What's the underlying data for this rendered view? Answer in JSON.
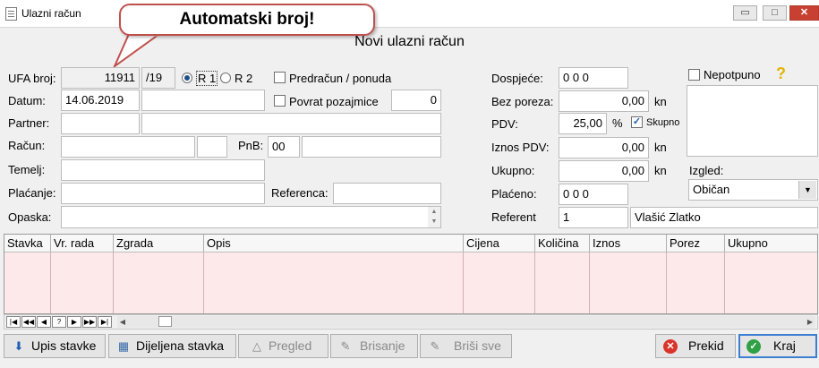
{
  "window": {
    "title": "Ulazni račun",
    "min": "▭",
    "max": "□",
    "close": "✕"
  },
  "callout": {
    "text": "Automatski broj!"
  },
  "form_title": "Novi ulazni račun",
  "left": {
    "ufa_label": "UFA broj:",
    "ufa_number": "11911",
    "ufa_year": "/19",
    "r1_label": "R 1",
    "r2_label": "R 2",
    "predracun_label": "Predračun / ponuda",
    "datum_label": "Datum:",
    "datum_value": "14.06.2019",
    "povrat_label": "Povrat pozajmice",
    "povrat_value": "0",
    "partner_label": "Partner:",
    "racun_label": "Račun:",
    "pnb_label": "PnB:",
    "pnb_value": "00",
    "temelj_label": "Temelj:",
    "placanje_label": "Plaćanje:",
    "referenca_label": "Referenca:",
    "opaska_label": "Opaska:"
  },
  "right": {
    "dospijece_label": "Dospjeće:",
    "dospijece_value": "0 0 0",
    "bez_poreza_label": "Bez poreza:",
    "bez_poreza_value": "0,00",
    "kn1": "kn",
    "pdv_label": "PDV:",
    "pdv_value": "25,00",
    "pct": "%",
    "skupno_label": "Skupno",
    "iznos_pdv_label": "Iznos PDV:",
    "iznos_pdv_value": "0,00",
    "kn2": "kn",
    "ukupno_label": "Ukupno:",
    "ukupno_value": "0,00",
    "kn3": "kn",
    "placeno_label": "Plaćeno:",
    "placeno_value": "0 0 0",
    "referent_label": "Referent",
    "referent_id": "1",
    "referent_name": "Vlašić Zlatko",
    "nepotpuno_label": "Nepotpuno",
    "help": "?",
    "izgled_label": "Izgled:",
    "izgled_value": "Običan"
  },
  "grid": {
    "columns": [
      "Stavka",
      "Vr. rada",
      "Zgrada",
      "Opis",
      "Cijena",
      "Količina",
      "Iznos",
      "Porez",
      "Ukupno"
    ]
  },
  "nav": [
    "|◀",
    "◀◀",
    "◀",
    "?",
    "▶",
    "▶▶",
    "▶|"
  ],
  "buttons": {
    "upis": "Upis stavke",
    "dijeljena": "Dijeljena stavka",
    "pregled": "Pregled",
    "brisanje": "Brisanje",
    "brisi_sve": "Briši sve",
    "prekid": "Prekid",
    "kraj": "Kraj"
  },
  "colors": {
    "grid_bg": "#fde8ea",
    "callout_border": "#c0504d",
    "close_btn": "#c84031"
  }
}
